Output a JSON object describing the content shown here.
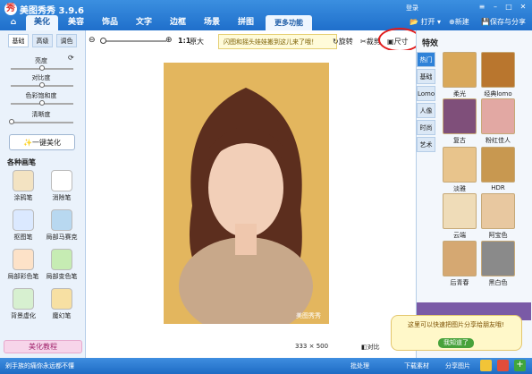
{
  "app": {
    "title": "美图秀秀 3.9.6",
    "login": "登录",
    "new": "新建",
    "save_share": "保存与分享",
    "open": "打开"
  },
  "tabs": [
    {
      "label": "美化"
    },
    {
      "label": "美容"
    },
    {
      "label": "饰品"
    },
    {
      "label": "文字"
    },
    {
      "label": "边框"
    },
    {
      "label": "场景"
    },
    {
      "label": "拼图"
    },
    {
      "label": "更多功能"
    }
  ],
  "left": {
    "subtabs": [
      {
        "label": "基础"
      },
      {
        "label": "高级"
      },
      {
        "label": "调色"
      }
    ],
    "sliders": [
      {
        "label": "亮度",
        "value": 0.5
      },
      {
        "label": "对比度",
        "value": 0.5
      },
      {
        "label": "色彩饱和度",
        "value": 0.5
      },
      {
        "label": "清晰度",
        "value": 0.0
      }
    ],
    "one_key": "一键美化",
    "brushes_title": "各种画笔",
    "tools": [
      {
        "label": "涂鸦笔"
      },
      {
        "label": "消除笔"
      },
      {
        "label": "抠图笔"
      },
      {
        "label": "局部马赛克"
      },
      {
        "label": "局部彩色笔"
      },
      {
        "label": "局部变色笔"
      },
      {
        "label": "背景虚化"
      },
      {
        "label": "魔幻笔"
      }
    ],
    "tutorial": "美化教程"
  },
  "toolbar": {
    "zoom_label": "1:1",
    "original": "原大",
    "notice": "闪图和摇头娃娃搬到这儿来了哦！",
    "rotate": "旋转",
    "crop": "裁剪",
    "size": "尺寸"
  },
  "canvas": {
    "watermark": "美图秀秀",
    "width": "333",
    "height": "500",
    "compare": "对比"
  },
  "right": {
    "title": "特效",
    "tabs": [
      {
        "label": "热门"
      },
      {
        "label": "基础"
      },
      {
        "label": "Lomo"
      },
      {
        "label": "人像"
      },
      {
        "label": "时尚"
      },
      {
        "label": "艺术"
      }
    ],
    "effects": [
      {
        "label": "柔光"
      },
      {
        "label": "经典lomo"
      },
      {
        "label": "复古"
      },
      {
        "label": "粉红佳人"
      },
      {
        "label": "淡雅"
      },
      {
        "label": "HDR"
      },
      {
        "label": "云端"
      },
      {
        "label": "阿宝色"
      },
      {
        "label": "后青春"
      },
      {
        "label": "黑白色"
      }
    ],
    "share_tip": "这里可以快速把图片分享给朋友哦!",
    "got_it": "我知道了"
  },
  "bottom": {
    "status": "剁手族的痛你永远都不懂",
    "batch": "批处理",
    "download": "下载素材",
    "share": "分享图片"
  }
}
